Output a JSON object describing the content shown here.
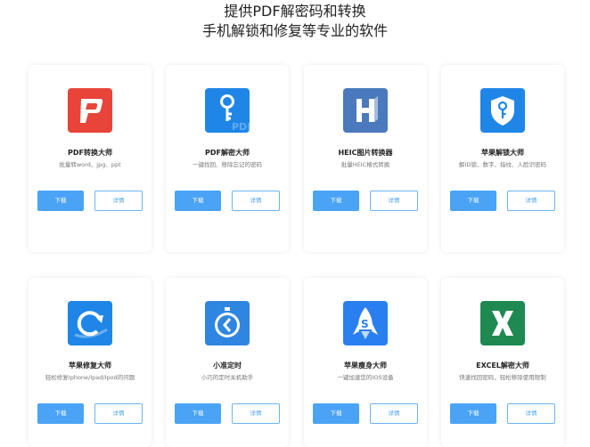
{
  "heading": {
    "line1": "提供PDF解密码和转换",
    "line2": "手机解锁和修复等专业的软件"
  },
  "buttons": {
    "download": "下载",
    "details": "详情"
  },
  "cards": [
    {
      "title": "PDF转换大师",
      "desc": "批量转word、jpg、ppt",
      "icon": "pdf-p-icon",
      "color": "#e8443a"
    },
    {
      "title": "PDF解密大师",
      "desc": "一键找回、移除忘记的密码",
      "icon": "key-icon",
      "color": "#1f86e8"
    },
    {
      "title": "HEIC图片转换器",
      "desc": "批量HEIC格式转换",
      "icon": "heic-h-icon",
      "color": "#4a79bd"
    },
    {
      "title": "苹果解锁大师",
      "desc": "解ID锁、数字、指纹、人脸识密码",
      "icon": "shield-key-icon",
      "color": "#1f86e8"
    },
    {
      "title": "苹果修复大师",
      "desc": "轻松修复Iphone/Ipad/Ipod的问题",
      "icon": "restore-icon",
      "color": "#1f86e8"
    },
    {
      "title": "小准定时",
      "desc": "小巧的定时关机助手",
      "icon": "timer-icon",
      "color": "#2f86e0"
    },
    {
      "title": "苹果瘦身大师",
      "desc": "一键加速您的IOS设备",
      "icon": "rocket-icon",
      "color": "#2a7ff0"
    },
    {
      "title": "EXCEL解密大师",
      "desc": "快速找回密码，轻松移除使用限制",
      "icon": "excel-x-icon",
      "color": "#1e8a52"
    }
  ]
}
